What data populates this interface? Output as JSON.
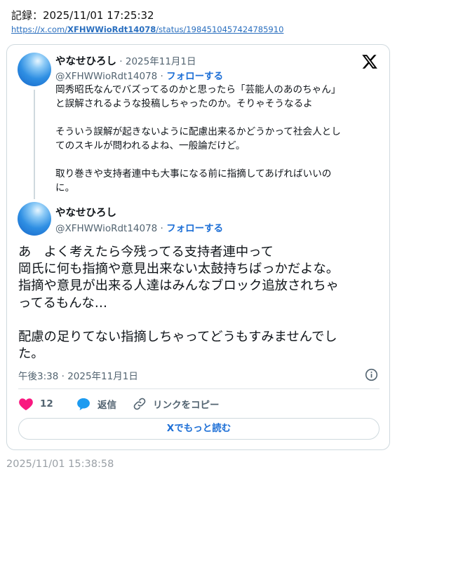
{
  "record": {
    "header": "記録：2025/11/01 17:25:32",
    "link_prefix": "https://x.com/",
    "link_user": "XFHWWioRdt14078",
    "link_suffix": "/status/1984510457424785910"
  },
  "quoted_post": {
    "author_name": "やなせひろし",
    "date": " · 2025年11月1日",
    "handle": "@XFHWWioRdt14078 · ",
    "follow_label": "フォローする",
    "text": "岡秀昭氏なんでバズってるのかと思ったら「芸能人のあのちゃん」\nと誤解されるような投稿しちゃったのか。そりゃそうなるよ\n\nそういう誤解が起きないように配慮出来るかどうかって社会人とし\nてのスキルが問われるよね、一般論だけど。\n\n取り巻きや支持者連中も大事になる前に指摘してあげればいいの\nに。"
  },
  "main_post": {
    "author_name": "やなせひろし",
    "handle": "@XFHWWioRdt14078 · ",
    "follow_label": "フォローする",
    "text": "あ　よく考えたら今残ってる支持者連中って\n岡氏に何も指摘や意見出来ない太鼓持ちばっかだよな。\n指摘や意見が出来る人達はみんなブロック追放されちゃ\nってるもんな…\n\n配慮の足りてない指摘しちゃってどうもすみませんでし\nた。",
    "timestamp": "午後3:38 · 2025年11月1日"
  },
  "actions": {
    "like_count": "12",
    "reply_label": "返信",
    "copy_link_label": "リンクをコピー"
  },
  "read_more_label": "Xでもっと読む",
  "footer_time": "2025/11/01 15:38:58",
  "colors": {
    "accent": "#1d6fd6",
    "like": "#f91880",
    "reply": "#1d9bf0",
    "muted": "#536471"
  },
  "icons": [
    "x-logo-icon",
    "info-icon",
    "heart-icon",
    "reply-bubble-icon",
    "link-icon"
  ]
}
